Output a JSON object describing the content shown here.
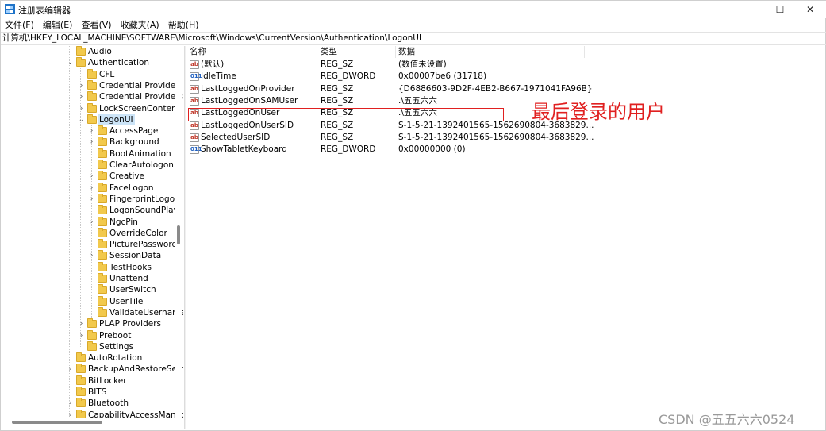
{
  "window": {
    "title": "注册表编辑器",
    "controls": {
      "minimize": "—",
      "maximize": "☐",
      "close": "✕"
    }
  },
  "menu": [
    "文件(F)",
    "编辑(E)",
    "查看(V)",
    "收藏夹(A)",
    "帮助(H)"
  ],
  "address": "计算机\\HKEY_LOCAL_MACHINE\\SOFTWARE\\Microsoft\\Windows\\CurrentVersion\\Authentication\\LogonUI",
  "tree": [
    {
      "label": "Audio",
      "expander": ""
    },
    {
      "label": "Authentication",
      "expander": "⌄"
    },
    {
      "label": "CFL",
      "expander": ""
    },
    {
      "label": "Credential Provider",
      "expander": "›"
    },
    {
      "label": "Credential Providers",
      "expander": "›"
    },
    {
      "label": "LockScreenContent",
      "expander": "›"
    },
    {
      "label": "LogonUI",
      "expander": "⌄",
      "selected": true
    },
    {
      "label": "AccessPage",
      "expander": "›"
    },
    {
      "label": "Background",
      "expander": "›"
    },
    {
      "label": "BootAnimation",
      "expander": ""
    },
    {
      "label": "ClearAutologon",
      "expander": ""
    },
    {
      "label": "Creative",
      "expander": "›"
    },
    {
      "label": "FaceLogon",
      "expander": "›"
    },
    {
      "label": "FingerprintLogon",
      "expander": "›"
    },
    {
      "label": "LogonSoundPlay",
      "expander": ""
    },
    {
      "label": "NgcPin",
      "expander": "›"
    },
    {
      "label": "OverrideColor",
      "expander": ""
    },
    {
      "label": "PicturePassword",
      "expander": ""
    },
    {
      "label": "SessionData",
      "expander": "›"
    },
    {
      "label": "TestHooks",
      "expander": ""
    },
    {
      "label": "Unattend",
      "expander": ""
    },
    {
      "label": "UserSwitch",
      "expander": ""
    },
    {
      "label": "UserTile",
      "expander": ""
    },
    {
      "label": "ValidateUsername",
      "expander": ""
    },
    {
      "label": "PLAP Providers",
      "expander": "›"
    },
    {
      "label": "Preboot",
      "expander": "›"
    },
    {
      "label": "Settings",
      "expander": ""
    },
    {
      "label": "AutoRotation",
      "expander": ""
    },
    {
      "label": "BackupAndRestoreSettings",
      "expander": "›"
    },
    {
      "label": "BitLocker",
      "expander": ""
    },
    {
      "label": "BITS",
      "expander": ""
    },
    {
      "label": "Bluetooth",
      "expander": "›"
    },
    {
      "label": "CapabilityAccessManager",
      "expander": "›"
    }
  ],
  "columns": {
    "name": "名称",
    "type": "类型",
    "data": "数据"
  },
  "values": [
    {
      "icon": "ab",
      "name": "(默认)",
      "type": "REG_SZ",
      "data": "(数值未设置)"
    },
    {
      "icon": "dword",
      "name": "IdleTime",
      "type": "REG_DWORD",
      "data": "0x00007be6 (31718)"
    },
    {
      "icon": "ab",
      "name": "LastLoggedOnProvider",
      "type": "REG_SZ",
      "data": "{D6886603-9D2F-4EB2-B667-1971041FA96B}"
    },
    {
      "icon": "ab",
      "name": "LastLoggedOnSAMUser",
      "type": "REG_SZ",
      "data": ".\\五五六六"
    },
    {
      "icon": "ab",
      "name": "LastLoggedOnUser",
      "type": "REG_SZ",
      "data": ".\\五五六六"
    },
    {
      "icon": "ab",
      "name": "LastLoggedOnUserSID",
      "type": "REG_SZ",
      "data": "S-1-5-21-1392401565-1562690804-3683829..."
    },
    {
      "icon": "ab",
      "name": "SelectedUserSID",
      "type": "REG_SZ",
      "data": "S-1-5-21-1392401565-1562690804-3683829..."
    },
    {
      "icon": "dword",
      "name": "ShowTabletKeyboard",
      "type": "REG_DWORD",
      "data": "0x00000000 (0)"
    }
  ],
  "icon_text": {
    "ab": "ab",
    "dword": "011"
  },
  "annotation": "最后登录的用户",
  "watermark": "CSDN @五五六六0524",
  "colors": {
    "annotation": "#e02020",
    "folder": "#f2c94c",
    "selection": "#cce4f7"
  }
}
